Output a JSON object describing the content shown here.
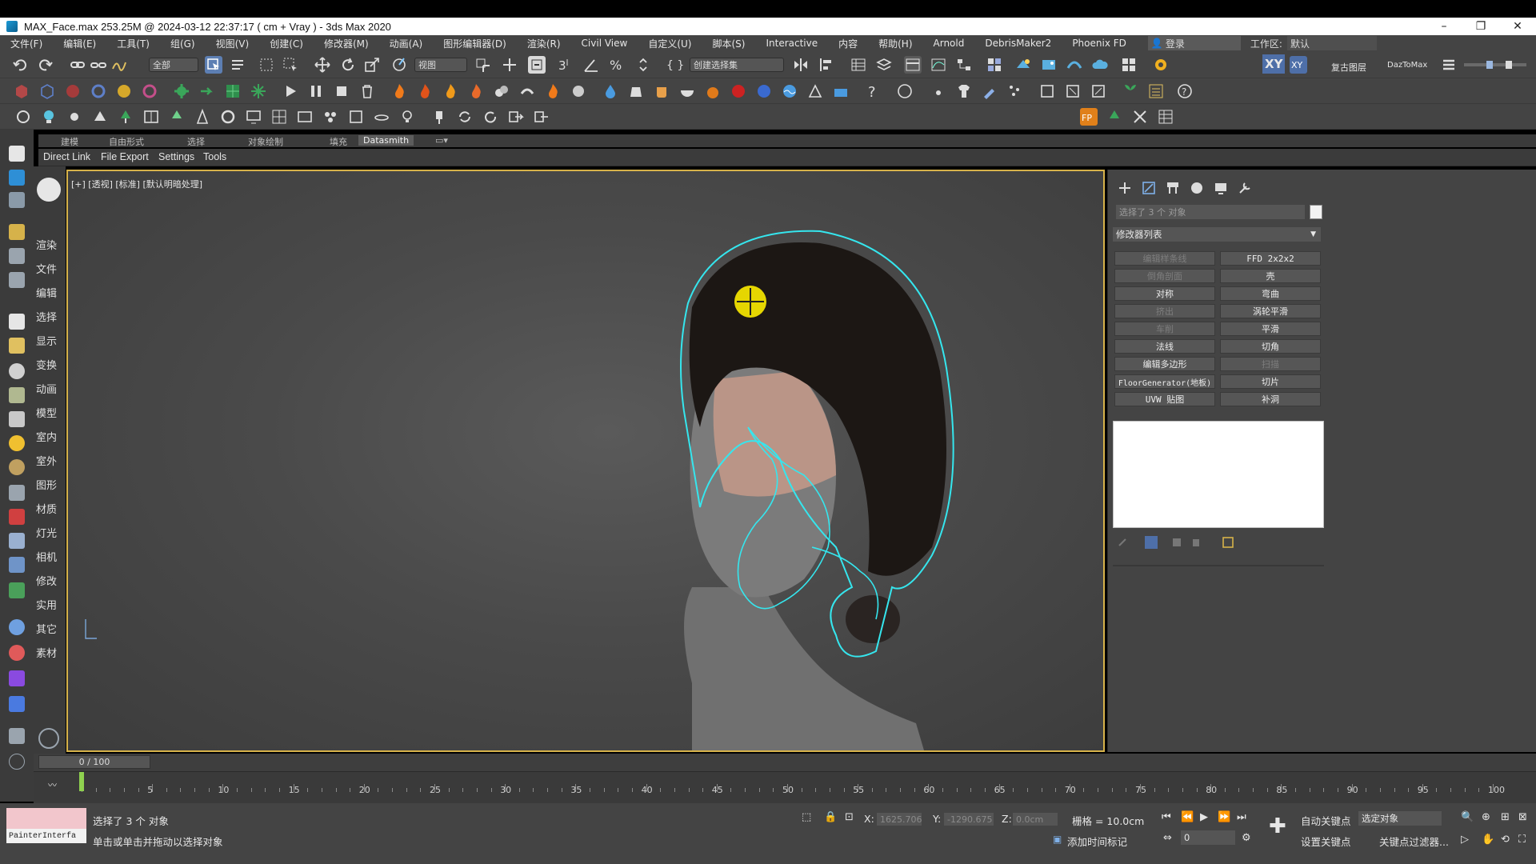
{
  "window": {
    "title": "MAX_Face.max  253.25M @ 2024-03-12 22:37:17  ( cm + Vray ) - 3ds Max 2020",
    "minimize": "–",
    "restore": "❐",
    "close": "✕"
  },
  "menu": {
    "items": [
      "文件(F)",
      "编辑(E)",
      "工具(T)",
      "组(G)",
      "视图(V)",
      "创建(C)",
      "修改器(M)",
      "动画(A)",
      "图形编辑器(D)",
      "渲染(R)",
      "Civil View",
      "自定义(U)",
      "脚本(S)",
      "Interactive",
      "内容",
      "帮助(H)",
      "Arnold",
      "DebrisMaker2",
      "Phoenix FD"
    ],
    "login": "登录",
    "workspace_label": "工作区:",
    "workspace_value": "默认"
  },
  "toolbar": {
    "filter_dropdown": "全部",
    "refcoord_dropdown": "视图",
    "selset_dropdown": "创建选择集",
    "axis_x": "X",
    "axis_y": "Y",
    "axis_z": "Z",
    "axis_xy": "XY",
    "layer_restore": "复古图层",
    "daztomax": "DazToMax"
  },
  "ribbon": {
    "tabs": [
      "建模",
      "自由形式",
      "选择",
      "对象绘制",
      "填充",
      "Datasmith"
    ],
    "active_tab": "Datasmith",
    "subtabs": [
      "Direct Link",
      "File Export",
      "Settings",
      "Tools"
    ]
  },
  "left_panel": {
    "labels": [
      "渲染",
      "文件",
      "编辑",
      "选择",
      "显示",
      "变换",
      "动画",
      "模型",
      "室内",
      "室外",
      "图形",
      "材质",
      "灯光",
      "相机",
      "修改",
      "实用",
      "其它",
      "素材"
    ]
  },
  "viewport": {
    "label": "[+] [透视] [标准] [默认明暗处理]"
  },
  "command_panel": {
    "selection_text": "选择了 3 个 对象",
    "modifier_list": "修改器列表",
    "modifier_buttons": [
      {
        "label": "编辑样条线",
        "enabled": false
      },
      {
        "label": "FFD 2x2x2",
        "enabled": true
      },
      {
        "label": "倒角剖面",
        "enabled": false
      },
      {
        "label": "壳",
        "enabled": true
      },
      {
        "label": "对称",
        "enabled": true
      },
      {
        "label": "弯曲",
        "enabled": true
      },
      {
        "label": "挤出",
        "enabled": false
      },
      {
        "label": "涡轮平滑",
        "enabled": true
      },
      {
        "label": "车削",
        "enabled": false
      },
      {
        "label": "平滑",
        "enabled": true
      },
      {
        "label": "法线",
        "enabled": true
      },
      {
        "label": "切角",
        "enabled": true
      },
      {
        "label": "编辑多边形",
        "enabled": true
      },
      {
        "label": "扫描",
        "enabled": false
      },
      {
        "label": "FloorGenerator(地板)",
        "enabled": true
      },
      {
        "label": "切片",
        "enabled": true
      },
      {
        "label": "UVW 贴图",
        "enabled": true
      },
      {
        "label": "补洞",
        "enabled": true
      }
    ]
  },
  "timeline": {
    "frame_display": "0 / 100",
    "ticks": [
      0,
      5,
      10,
      15,
      20,
      25,
      30,
      35,
      40,
      45,
      50,
      55,
      60,
      65,
      70,
      75,
      80,
      85,
      90,
      95,
      100
    ]
  },
  "status": {
    "maxscript_label": "PainterInterfa",
    "selected": "选择了 3 个 对象",
    "prompt": "单击或单击并拖动以选择对象",
    "x_label": "X:",
    "x_value": "1625.706",
    "y_label": "Y:",
    "y_value": "-1290.675",
    "z_label": "Z:",
    "z_value": "0.0cm",
    "grid": "栅格 = 10.0cm",
    "add_time_tag": "添加时间标记",
    "auto_key": "自动关键点",
    "selected_object": "选定对象",
    "set_key": "设置关键点",
    "key_filters": "关键点过滤器...",
    "frame_field": "0"
  },
  "colors": {
    "ui_bg": "#444444",
    "viewport_border": "#d6b24a",
    "selection_outline": "#35e6ee",
    "gizmo": "#f0e000"
  }
}
